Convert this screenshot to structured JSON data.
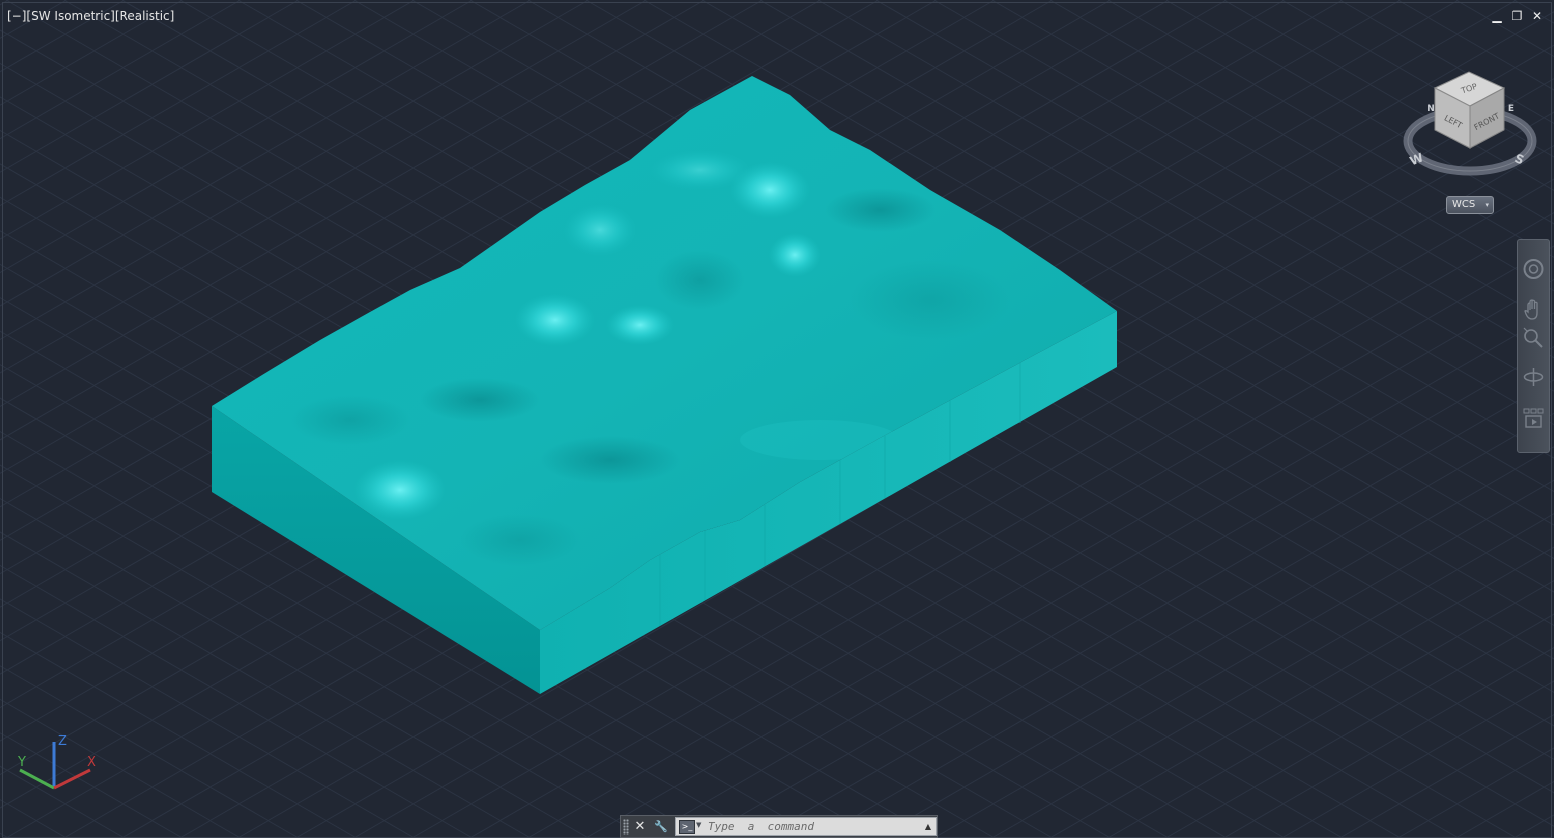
{
  "viewport": {
    "controls_label": "[−]",
    "view_label": "[SW Isometric]",
    "style_label": "[Realistic]"
  },
  "window_controls": {
    "minimize": "▁",
    "restore": "❐",
    "close": "✕"
  },
  "viewcube": {
    "face_top": "TOP",
    "face_left": "LEFT",
    "face_front": "FRONT",
    "compass_w": "W",
    "compass_s": "S",
    "compass_n": "N",
    "compass_e": "E"
  },
  "wcs_menu": {
    "label": "WCS"
  },
  "ucs": {
    "x": "X",
    "y": "Y",
    "z": "Z"
  },
  "command_line": {
    "close_glyph": "✕",
    "customize_glyph": "🔧",
    "prompt_glyph": ">_",
    "prompt_caret": "▼",
    "placeholder": "Type  a  command",
    "history_glyph": "▲"
  },
  "colors": {
    "background": "#212733",
    "grid": "#2e3645",
    "terrain_top": "#12b5b5",
    "terrain_highlight": "#3fe3e8",
    "terrain_shadow": "#0a8f92",
    "side_front": "#06a2a3",
    "side_right": "#15b8b8"
  },
  "icons": {
    "steering_wheel": "steering-wheel-icon",
    "pan": "pan-icon",
    "zoom": "zoom-extents-icon",
    "orbit": "orbit-icon",
    "showmotion": "showmotion-icon"
  }
}
